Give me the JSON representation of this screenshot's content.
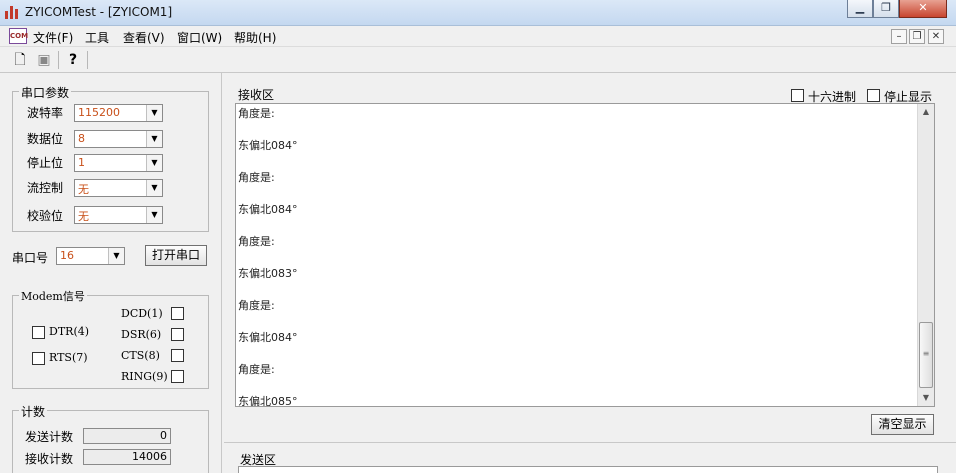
{
  "window": {
    "title": "ZYICOMTest - [ZYICOM1]"
  },
  "menu": {
    "icon_text": "COM",
    "items": [
      "文件(F)",
      "工具",
      "查看(V)",
      "窗口(W)",
      "帮助(H)"
    ]
  },
  "serial_params": {
    "title": "串口参数",
    "baud_label": "波特率",
    "baud_value": "115200",
    "data_bits_label": "数据位",
    "data_bits_value": "8",
    "stop_bits_label": "停止位",
    "stop_bits_value": "1",
    "flow_label": "流控制",
    "flow_value": "无",
    "parity_label": "校验位",
    "parity_value": "无"
  },
  "port": {
    "label": "串口号",
    "value": "16",
    "open_button": "打开串口"
  },
  "modem": {
    "title": "Modem信号",
    "dtr": "DTR(4)",
    "rts": "RTS(7)",
    "dcd": "DCD(1)",
    "dsr": "DSR(6)",
    "cts": "CTS(8)",
    "ring": "RING(9)"
  },
  "counters": {
    "title": "计数",
    "send_label": "发送计数",
    "send_value": "0",
    "recv_label": "接收计数",
    "recv_value": "14006"
  },
  "receive": {
    "title": "接收区",
    "hex_label": "十六进制",
    "stop_display_label": "停止显示",
    "lines": [
      "角度是:",
      "东偏北084°",
      "角度是:",
      "东偏北084°",
      "角度是:",
      "东偏北083°",
      "角度是:",
      "东偏北084°",
      "角度是:",
      "东偏北085°"
    ],
    "clear_button": "清空显示"
  },
  "send": {
    "title": "发送区"
  }
}
